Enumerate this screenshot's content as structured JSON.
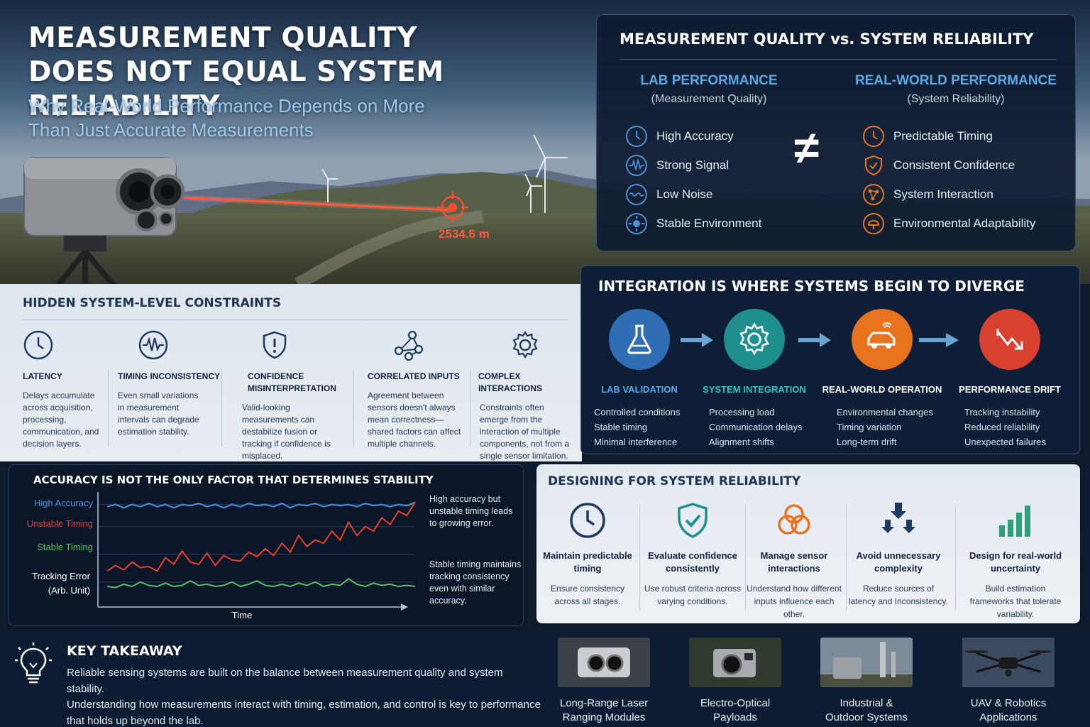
{
  "hero": {
    "title_line1": "MEASUREMENT QUALITY",
    "title_line2": "DOES NOT EQUAL SYSTEM RELIABILITY",
    "subtitle_line1": "Why Real-World Performance Depends on More",
    "subtitle_line2": "Than Just Accurate Measurements",
    "distance_readout": "2534.6 m"
  },
  "comparison": {
    "title": "MEASUREMENT QUALITY vs. SYSTEM RELIABILITY",
    "left_heading": "LAB PERFORMANCE",
    "left_sub": "(Measurement Quality)",
    "right_heading": "REAL-WORLD PERFORMANCE",
    "right_sub": "(System Reliability)",
    "symbol": "≠",
    "left_items": [
      "High Accuracy",
      "Strong Signal",
      "Low Noise",
      "Stable Environment"
    ],
    "right_items": [
      "Predictable Timing",
      "Consistent Confidence",
      "System Interaction",
      "Environmental Adaptability"
    ]
  },
  "hidden": {
    "title": "HIDDEN SYSTEM-LEVEL CONSTRAINTS",
    "items": [
      {
        "title": "LATENCY",
        "desc": "Delays accumulate across acquisition, processing, communication, and decision layers."
      },
      {
        "title": "TIMING INCONSISTENCY",
        "desc": "Even small variations in measurement intervals can degrade estimation stability."
      },
      {
        "title": "CONFIDENCE MISINTERPRETATION",
        "desc": "Valid-looking measurements can destabilize fusion or tracking if confidence is misplaced."
      },
      {
        "title": "CORRELATED INPUTS",
        "desc": "Agreement between sensors doesn't always mean correctness—shared factors can affect multiple channels."
      },
      {
        "title": "COMPLEX INTERACTIONS",
        "desc": "Constraints often emerge from the interaction of multiple components, not from a single sensor limitation."
      }
    ]
  },
  "integration": {
    "title": "INTEGRATION IS WHERE SYSTEMS BEGIN TO DIVERGE",
    "stages": [
      {
        "title": "LAB VALIDATION",
        "items": [
          "Controlled conditions",
          "Stable timing",
          "Minimal interference"
        ],
        "color": "#2f6db5"
      },
      {
        "title": "SYSTEM INTEGRATION",
        "items": [
          "Processing load",
          "Communication delays",
          "Alignment shifts"
        ],
        "color": "#1e8e8e"
      },
      {
        "title": "REAL-WORLD OPERATION",
        "items": [
          "Environmental changes",
          "Timing variation",
          "Long-term drift"
        ],
        "color": "#e8731f"
      },
      {
        "title": "PERFORMANCE DRIFT",
        "items": [
          "Tracking instability",
          "Reduced reliability",
          "Unexpected failures"
        ],
        "color": "#d8402f"
      }
    ]
  },
  "chart": {
    "title": "ACCURACY IS NOT THE ONLY FACTOR THAT DETERMINES STABILITY",
    "note_top": "High accuracy but unstable timing leads to growing error.",
    "note_bottom": "Stable timing maintains tracking consistency even with similar accuracy."
  },
  "chart_data": {
    "type": "line",
    "title": "ACCURACY IS NOT THE ONLY FACTOR THAT DETERMINES STABILITY",
    "xlabel": "Time",
    "ylabel": "Tracking Error (Arb. Unit)",
    "series": [
      {
        "name": "High Accuracy",
        "color": "#4f93e0",
        "values": [
          0.88,
          0.9,
          0.87,
          0.9,
          0.88,
          0.91,
          0.88,
          0.9,
          0.87,
          0.9,
          0.89,
          0.91,
          0.88,
          0.9,
          0.87,
          0.9,
          0.88,
          0.91,
          0.89,
          0.9,
          0.88,
          0.91,
          0.87,
          0.9,
          0.89,
          0.91,
          0.88,
          0.9,
          0.89,
          0.9,
          0.88,
          0.91,
          0.89,
          0.9,
          0.88,
          0.9,
          0.89,
          0.92
        ]
      },
      {
        "name": "Unstable Timing",
        "color": "#e8402c",
        "values": [
          0.3,
          0.35,
          0.31,
          0.38,
          0.33,
          0.34,
          0.3,
          0.42,
          0.36,
          0.48,
          0.38,
          0.36,
          0.46,
          0.35,
          0.44,
          0.4,
          0.39,
          0.47,
          0.43,
          0.5,
          0.44,
          0.55,
          0.47,
          0.62,
          0.52,
          0.58,
          0.55,
          0.66,
          0.58,
          0.74,
          0.62,
          0.7,
          0.66,
          0.78,
          0.72,
          0.84,
          0.8,
          0.92
        ]
      },
      {
        "name": "Stable Timing",
        "color": "#58c067",
        "values": [
          0.16,
          0.15,
          0.18,
          0.16,
          0.2,
          0.17,
          0.16,
          0.19,
          0.16,
          0.17,
          0.21,
          0.17,
          0.18,
          0.16,
          0.17,
          0.2,
          0.16,
          0.18,
          0.21,
          0.17,
          0.16,
          0.18,
          0.16,
          0.19,
          0.17,
          0.2,
          0.16,
          0.18,
          0.17,
          0.23,
          0.18,
          0.16,
          0.19,
          0.17,
          0.18,
          0.16,
          0.17,
          0.16
        ]
      }
    ],
    "grid": true
  },
  "design": {
    "title": "DESIGNING FOR SYSTEM RELIABILITY",
    "items": [
      {
        "title": "Maintain predictable timing",
        "desc": "Ensure consistency across all stages."
      },
      {
        "title": "Evaluate confidence consistently",
        "desc": "Use robust criteria across varying conditions."
      },
      {
        "title": "Manage sensor interactions",
        "desc": "Understand how different inputs influence each other."
      },
      {
        "title": "Avoid unnecessary complexity",
        "desc": "Reduce sources of latency and Inconsistency."
      },
      {
        "title": "Design for real-world uncertainty",
        "desc": "Build estimation frameworks that tolerate variability."
      }
    ]
  },
  "takeaway": {
    "title": "KEY TAKEAWAY",
    "line1": "Reliable sensing systems are built on the balance between measurement quality and system stability.",
    "line2": "Understanding how measurements interact with timing, estimation, and control is key to performance",
    "line3": "that holds up beyond the lab."
  },
  "applications": [
    {
      "line1": "Long-Range Laser",
      "line2": "Ranging Modules"
    },
    {
      "line1": "Electro-Optical",
      "line2": "Payloads"
    },
    {
      "line1": "Industrial &",
      "line2": "Outdoor Systems"
    },
    {
      "line1": "UAV & Robotics",
      "line2": "Applications"
    }
  ],
  "colors": {
    "accent_blue": "#5ba9e8",
    "accent_orange": "#e8731f",
    "laser_red": "#ff4a2e",
    "navy": "#0e1c33"
  }
}
